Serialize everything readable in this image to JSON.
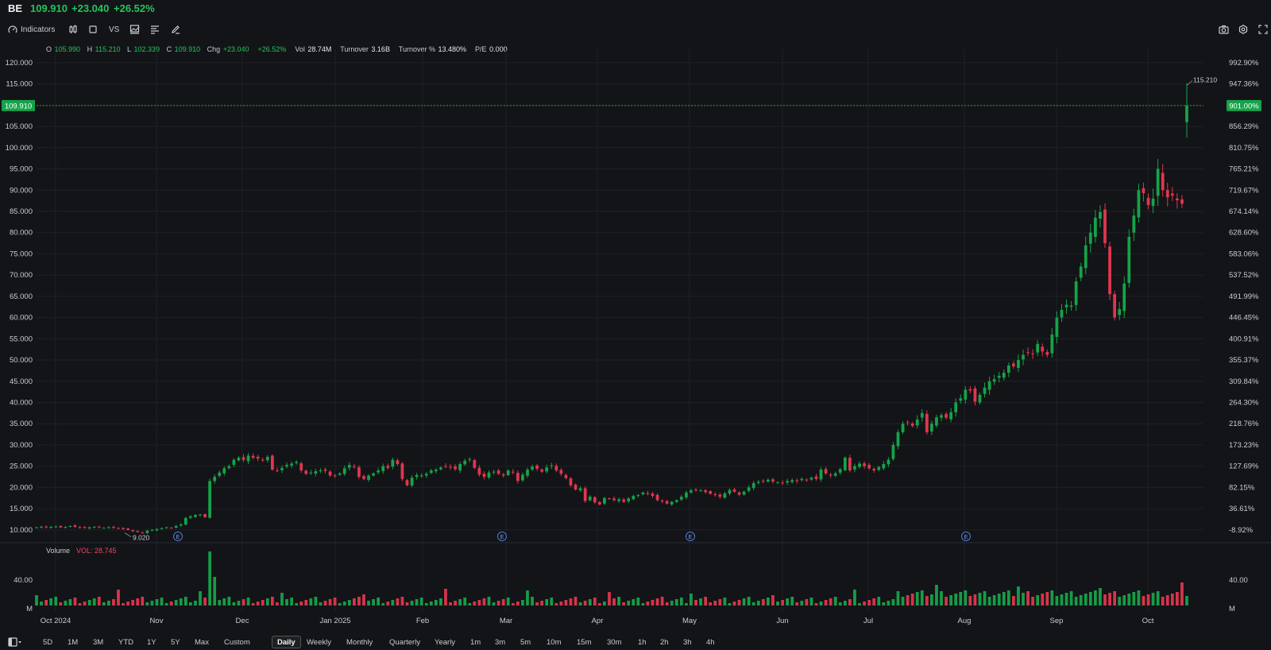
{
  "header": {
    "ticker": "BE",
    "last": "109.910",
    "change": "+23.040",
    "change_pct": "+26.52%"
  },
  "toolbar": {
    "indicators_label": "Indicators",
    "vs_label": "VS"
  },
  "ohlc": {
    "o_label": "O",
    "o": "105.990",
    "h_label": "H",
    "h": "115.210",
    "l_label": "L",
    "l": "102.339",
    "c_label": "C",
    "c": "109.910",
    "chg_label": "Chg",
    "chg": "+23.040",
    "chg_pct": "+26.52%",
    "vol_label": "Vol",
    "vol": "28.74M",
    "turnover_label": "Turnover",
    "turnover": "3.16B",
    "turnover_pct_label": "Turnover %",
    "turnover_pct": "13.480%",
    "pe_label": "P/E",
    "pe": "0.000"
  },
  "volume_panel": {
    "title": "Volume",
    "value": "VOL: 28.745"
  },
  "timeframes": {
    "ranges": [
      "5D",
      "1M",
      "3M",
      "YTD",
      "1Y",
      "5Y",
      "Max",
      "Custom"
    ],
    "intervals": [
      "Daily",
      "Weekly",
      "Monthly",
      "Quarterly",
      "Yearly",
      "1m",
      "3m",
      "5m",
      "10m",
      "15m",
      "30m",
      "1h",
      "2h",
      "3h",
      "4h"
    ],
    "active": "Daily"
  },
  "colors": {
    "up": "#16a34a",
    "down": "#e0364f",
    "last_price_tag": "#16a34a",
    "grid": "#1e2126"
  },
  "icons": [
    "indicators-icon",
    "candles-icon",
    "rectangle-icon",
    "compare-icon",
    "chart-type-icon",
    "list-icon",
    "draw-icon",
    "camera-icon",
    "settings-icon",
    "fullscreen-icon",
    "layout-icon"
  ],
  "chart_data": {
    "type": "candlestick",
    "y_ticks_left": [
      "120.000",
      "115.000",
      "110.000",
      "105.000",
      "100.000",
      "95.000",
      "90.000",
      "85.000",
      "80.000",
      "75.000",
      "70.000",
      "65.000",
      "60.000",
      "55.000",
      "50.000",
      "45.000",
      "40.000",
      "35.000",
      "30.000",
      "25.000",
      "20.000",
      "15.000",
      "10.000"
    ],
    "y_ticks_right": [
      "992.90%",
      "947.36%",
      "901.00%",
      "856.29%",
      "810.75%",
      "765.21%",
      "719.67%",
      "674.14%",
      "628.60%",
      "583.06%",
      "537.52%",
      "491.99%",
      "446.45%",
      "400.91%",
      "355.37%",
      "309.84%",
      "264.30%",
      "218.76%",
      "173.23%",
      "127.69%",
      "82.15%",
      "36.61%",
      "-8.92%"
    ],
    "ylim": [
      10,
      120
    ],
    "x_labels": [
      "Oct 2024",
      "Nov",
      "Dec",
      "Jan 2025",
      "Feb",
      "Mar",
      "Apr",
      "May",
      "Jun",
      "Jul",
      "Aug",
      "Sep",
      "Oct"
    ],
    "last_price_label": "109.910",
    "last_pct_label": "901.00%",
    "high_marker": "115.210",
    "low_marker": "9.020",
    "earnings_marker": "E",
    "volume_ticks": [
      "40.00",
      "M"
    ],
    "volume_ticks_right": [
      "40.00",
      "M"
    ],
    "closes": [
      10.6,
      10.7,
      10.6,
      10.7,
      10.8,
      10.6,
      10.7,
      10.9,
      10.7,
      10.6,
      10.5,
      10.6,
      10.7,
      10.6,
      10.5,
      10.6,
      10.5,
      10.4,
      10.2,
      10.0,
      9.7,
      9.5,
      9.3,
      9.8,
      10.0,
      10.2,
      10.4,
      10.6,
      10.5,
      10.9,
      11.3,
      12.8,
      13.2,
      13.5,
      13.6,
      13.0,
      21.5,
      22.5,
      23.5,
      24.5,
      25.0,
      26.5,
      27.0,
      26.5,
      27.5,
      27.0,
      26.8,
      26.4,
      27.2,
      24.2,
      24.0,
      24.6,
      25.3,
      25.6,
      26.0,
      24.0,
      23.2,
      23.5,
      23.8,
      24.0,
      23.9,
      22.8,
      22.7,
      23.3,
      24.5,
      25.3,
      24.8,
      22.5,
      22.0,
      22.8,
      23.3,
      24.0,
      25.0,
      24.6,
      26.5,
      25.5,
      22.0,
      20.5,
      22.3,
      22.9,
      22.8,
      23.2,
      24.0,
      24.2,
      24.7,
      25.0,
      24.8,
      24.3,
      25.5,
      26.3,
      26.7,
      24.6,
      23.0,
      22.5,
      23.5,
      23.7,
      23.2,
      22.8,
      24.0,
      23.5,
      21.5,
      23.0,
      24.2,
      24.9,
      24.4,
      23.7,
      24.7,
      25.2,
      24.0,
      23.2,
      22.2,
      20.5,
      19.5,
      19.8,
      16.8,
      17.8,
      16.5,
      16.0,
      17.5,
      17.3,
      17.0,
      17.2,
      16.6,
      17.4,
      18.0,
      18.2,
      18.8,
      18.5,
      18.0,
      17.0,
      16.7,
      16.2,
      16.6,
      17.0,
      17.8,
      18.8,
      19.3,
      19.4,
      19.3,
      18.9,
      18.5,
      18.2,
      17.8,
      18.6,
      19.4,
      19.0,
      18.3,
      19.0,
      20.0,
      21.0,
      21.3,
      21.5,
      21.8,
      21.4,
      21.2,
      21.0,
      21.5,
      21.7,
      21.5,
      22.0,
      21.8,
      22.3,
      22.0,
      24.2,
      23.3,
      22.8,
      23.3,
      24.3,
      27.0,
      24.0,
      25.0,
      25.6,
      25.0,
      24.5,
      24.0,
      24.8,
      25.5,
      26.5,
      30.0,
      33.0,
      35.0,
      35.3,
      34.5,
      36.0,
      37.5,
      33.0,
      35.0,
      36.5,
      37.0,
      36.4,
      37.7,
      40.0,
      41.0,
      43.0,
      42.8,
      40.2,
      41.8,
      43.5,
      45.0,
      45.5,
      46.3,
      47.0,
      48.7,
      48.5,
      50.0,
      51.2,
      51.8,
      51.5,
      53.8,
      52.0,
      51.2,
      56.0,
      60.0,
      61.8,
      63.0,
      62.8,
      68.5,
      72.0,
      77.0,
      80.0,
      83.5,
      84.8,
      77.5,
      65.5,
      60.0,
      62.0,
      68.0,
      79.0,
      84.0,
      90.0,
      89.3,
      86.5,
      88.0,
      95.0,
      90.0,
      88.3,
      88.7,
      87.6,
      86.8,
      109.9
    ]
  }
}
